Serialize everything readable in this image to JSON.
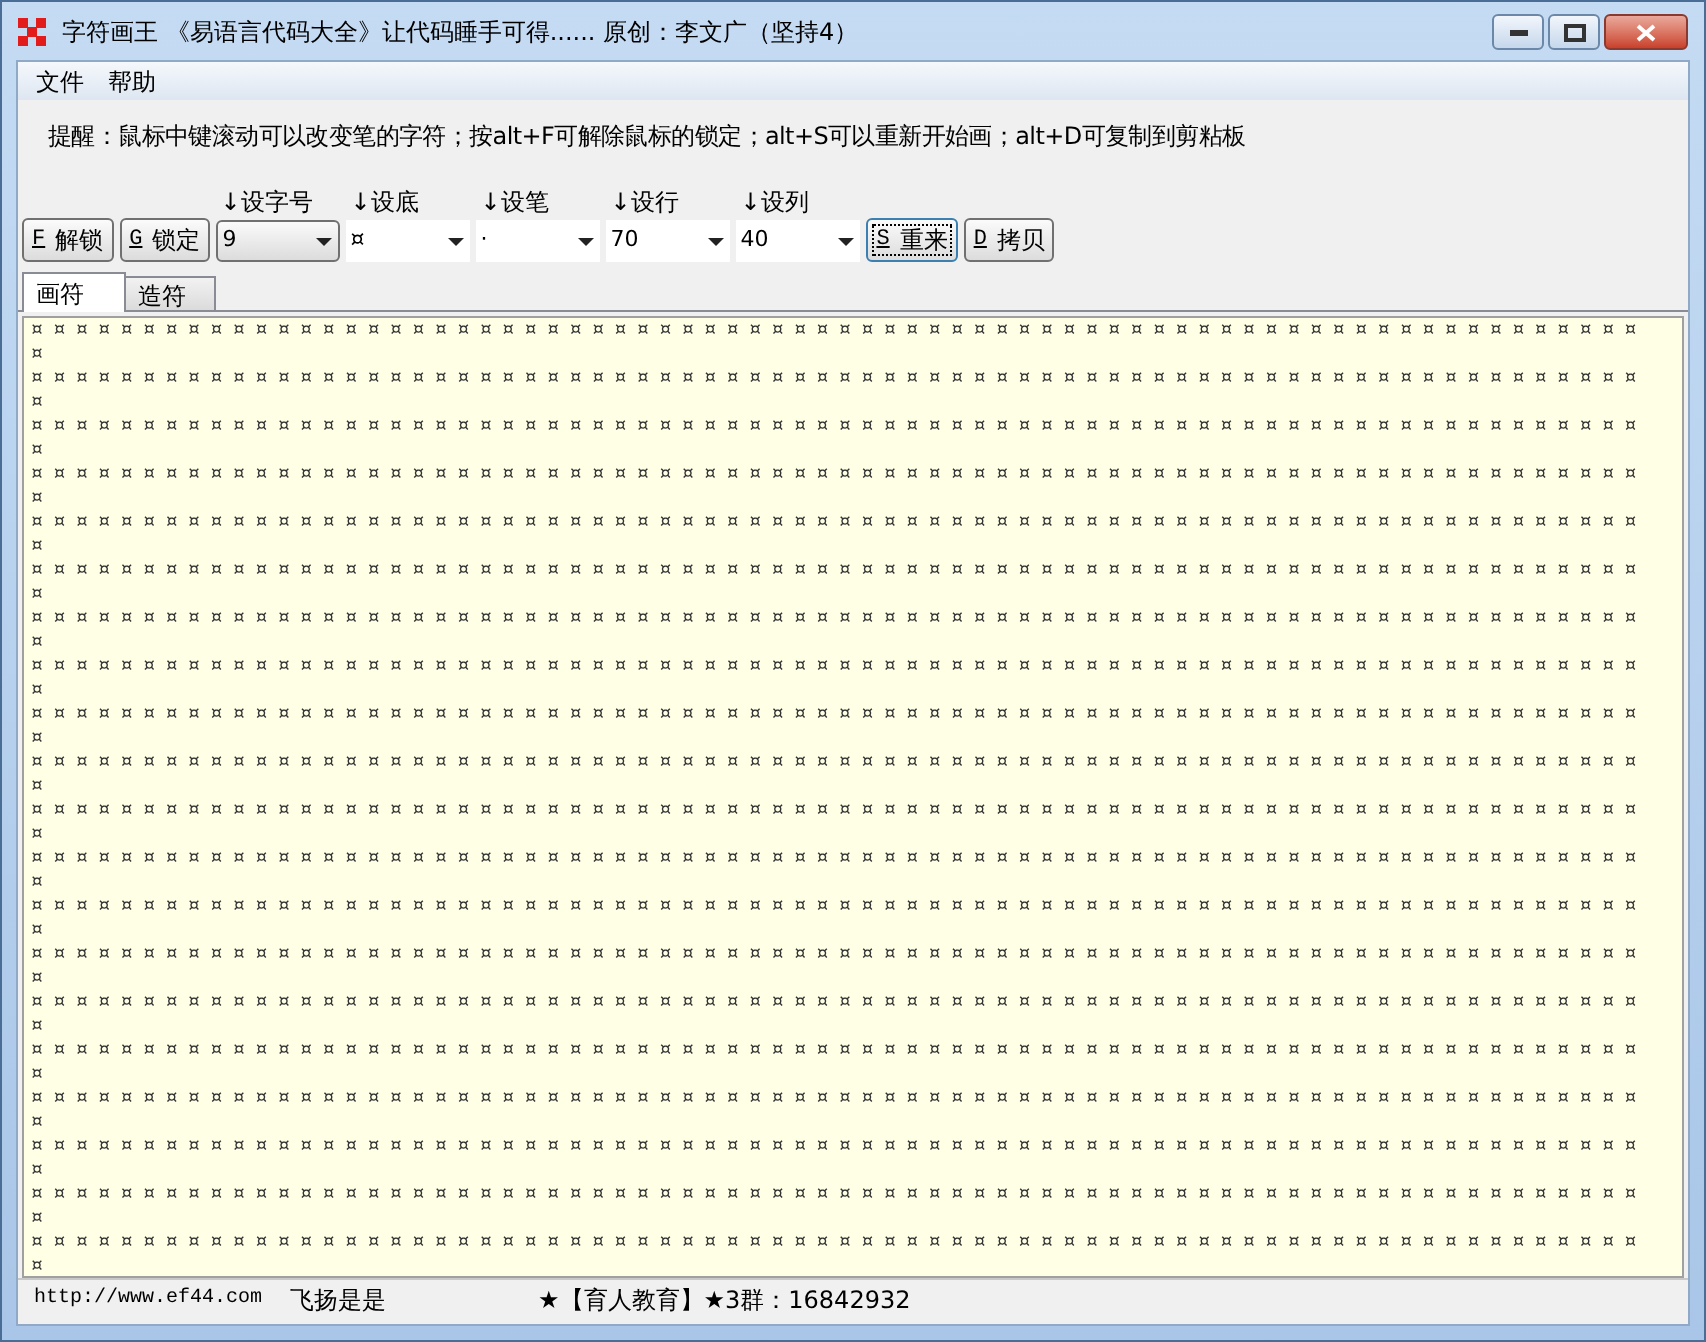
{
  "window": {
    "title": "字符画王 《易语言代码大全》让代码睡手可得...... 原创：李文广（坚持4）"
  },
  "menu": [
    "文件",
    "帮助"
  ],
  "hint": "提醒：鼠标中键滚动可以改变笔的字符；按alt+F可解除鼠标的锁定；alt+S可以重新开始画；alt+D可复制到剪粘板",
  "toolbar": [
    {
      "kind": "button",
      "key": "F",
      "label": "解锁",
      "focused": false
    },
    {
      "kind": "button",
      "key": "G",
      "label": "锁定",
      "focused": false
    },
    {
      "kind": "combo",
      "caption": "↓设字号",
      "value": "9"
    },
    {
      "kind": "combo",
      "caption": "↓设底",
      "value": "¤"
    },
    {
      "kind": "combo",
      "caption": "↓设笔",
      "value": "·"
    },
    {
      "kind": "combo",
      "caption": "↓设行",
      "value": "70"
    },
    {
      "kind": "combo",
      "caption": "↓设列",
      "value": "40"
    },
    {
      "kind": "button",
      "key": "S",
      "label": "重来",
      "focused": true
    },
    {
      "kind": "button",
      "key": "D",
      "label": "拷贝",
      "focused": false
    }
  ],
  "tabs": [
    {
      "label": "画符",
      "selected": true
    },
    {
      "label": "造符",
      "selected": false
    }
  ],
  "canvas": {
    "rows": [
      "¤¤¤¤¤¤¤¤¤¤¤¤¤¤¤¤¤¤¤¤¤¤¤¤¤¤¤¤¤¤¤¤¤¤¤¤¤¤¤¤¤¤¤¤¤¤¤¤¤¤¤¤¤¤¤¤¤¤¤¤¤¤¤¤¤¤¤¤¤¤¤¤¤",
      "¤¤¤¤¤¤¤¤¤¤¤¤¤¤¤¤¤¤¤¤¤¤¤¤¤¤¤¤¤¤¤¤¤¤¤¤¤¤¤¤¤¤¤¤¤¤¤¤¤¤¤¤¤¤¤¤¤¤¤¤¤¤¤¤¤¤¤¤¤¤¤¤¤",
      "¤¤¤¤¤¤¤¤¤¤¤¤¤¤¤¤¤¤¤¤¤¤¤¤¤¤¤¤¤¤¤¤¤¤¤¤¤¤¤¤¤¤¤¤¤¤¤¤¤¤¤¤¤¤¤¤¤¤¤¤¤¤¤¤¤¤¤¤¤¤¤¤¤",
      "¤¤¤¤¤¤¤¤¤¤¤¤¤¤¤¤¤¤¤¤¤¤¤¤¤¤¤¤¤¤¤¤¤¤¤¤¤¤¤¤¤¤¤¤¤¤¤¤¤¤¤¤¤¤¤¤¤¤¤¤¤¤¤¤¤¤¤¤¤¤¤¤¤",
      "¤¤¤¤¤¤¤¤¤¤¤¤¤¤¤¤¤¤¤¤¤¤¤¤¤¤¤¤¤¤¤¤¤¤¤¤¤¤¤¤¤¤¤¤¤¤¤¤¤¤¤¤¤¤¤¤¤¤¤¤¤¤¤¤¤¤¤¤¤¤¤¤¤",
      "¤¤¤¤¤¤¤¤¤¤¤¤¤¤¤¤¤¤¤¤¤¤¤¤¤¤¤¤¤¤¤¤¤¤¤¤¤¤¤¤¤¤¤¤¤¤¤¤¤¤¤¤¤¤¤¤¤¤¤¤¤¤¤¤¤¤¤¤¤¤¤¤¤",
      "¤¤¤¤¤¤¤¤¤¤¤¤¤¤¤¤¤¤¤¤¤¤¤¤¤¤¤¤¤¤¤¤¤¤¤¤¤¤¤¤¤¤¤¤¤¤¤¤¤¤¤¤¤¤¤¤¤¤¤¤¤¤¤¤¤¤¤¤¤¤¤¤¤",
      "¤¤¤¤¤¤¤¤¤¤¤¤¤¤¤¤¤¤¤¤¤¤¤¤¤¤¤¤¤¤¤¤¤¤¤¤¤¤¤¤¤¤¤¤¤¤¤¤¤¤¤¤¤¤¤¤¤¤¤¤¤¤¤¤¤¤¤¤¤¤¤¤¤",
      "¤¤¤¤¤¤¤¤¤¤¤¤¤¤¤¤¤¤¤¤¤¤¤¤¤¤¤¤¤¤¤¤¤¤¤¤¤¤¤¤¤¤¤¤¤¤¤¤¤¤¤¤¤¤¤¤¤¤¤¤¤¤¤¤¤¤¤¤¤¤¤¤¤",
      "¤¤¤¤¤¤¤¤¤¤¤¤¤¤¤¤¤¤¤¤¤¤¤¤¤¤¤¤¤¤¤¤¤¤¤¤¤¤¤¤¤¤¤¤¤¤¤¤¤¤¤¤¤¤¤¤¤¤¤¤¤¤¤¤¤¤¤¤¤¤¤¤¤",
      "¤¤¤¤¤¤¤¤¤¤¤¤¤¤¤¤¤¤¤¤¤¤¤¤¤¤¤¤¤¤¤¤¤¤¤¤¤¤¤¤¤¤¤¤¤¤¤¤¤¤¤¤¤¤¤¤¤¤¤¤¤¤¤¤¤¤¤¤¤¤¤¤¤",
      "¤¤¤¤¤¤¤¤¤¤¤¤¤¤¤¤¤¤¤¤¤¤¤¤¤¤¤¤¤¤¤¤¤¤¤¤¤¤¤¤¤¤¤¤¤¤¤¤¤¤¤¤¤¤¤¤¤¤¤¤¤¤¤¤¤¤¤¤¤¤¤¤¤",
      "¤¤¤¤¤¤¤¤¤¤¤¤¤¤¤¤¤¤¤¤¤¤¤¤¤¤¤¤¤¤¤¤¤¤¤¤¤¤¤¤¤¤¤¤¤¤¤¤¤¤¤¤¤¤¤¤¤¤¤¤¤¤¤¤¤¤¤¤¤¤¤¤¤",
      "¤¤¤¤¤¤¤¤¤¤¤¤¤¤¤¤¤¤¤¤¤¤¤¤¤¤¤¤¤¤¤¤¤¤¤¤¤¤¤¤¤¤¤¤¤¤¤¤¤¤¤¤¤¤¤¤¤¤¤¤¤¤¤¤¤¤¤¤¤¤¤¤¤",
      "¤¤¤¤¤¤¤¤¤¤¤¤¤¤¤¤¤¤¤¤¤¤¤¤¤¤¤¤¤¤¤¤¤¤¤¤¤¤¤¤¤¤¤¤¤¤¤¤¤¤¤¤¤¤¤¤¤¤¤¤¤¤¤¤¤¤¤¤¤¤¤¤¤",
      "¤¤¤¤¤¤¤¤¤¤¤¤¤¤¤¤¤¤¤¤¤¤¤¤¤¤¤¤¤¤¤¤¤¤¤¤¤¤¤¤¤¤¤¤¤¤¤¤¤¤¤¤¤¤¤¤¤¤¤¤¤¤¤¤¤¤¤¤¤¤¤¤¤",
      "¤¤¤¤¤¤¤¤¤¤¤¤¤¤¤¤¤¤¤¤¤¤¤¤¤¤¤¤¤¤¤¤¤¤¤¤¤¤¤¤¤¤¤¤¤¤¤¤¤¤¤¤¤¤¤¤¤¤¤¤¤¤¤¤¤¤¤¤¤¤¤¤¤",
      "¤¤¤¤¤¤¤¤¤¤¤¤¤¤¤¤¤¤¤¤¤¤¤¤¤¤¤¤¤¤¤¤¤¤¤¤¤¤¤¤¤¤¤¤¤¤¤¤¤¤¤¤¤¤¤¤¤¤¤¤¤¤¤¤¤¤¤¤¤¤¤¤¤",
      "¤¤¤¤¤¤¤¤¤¤¤¤¤¤¤¤¤¤¤¤¤¤¤¤¤¤¤¤¤¤¤¤¤¤¤¤¤¤¤¤¤¤¤¤¤¤¤¤¤¤¤¤¤¤¤¤¤¤¤¤¤¤¤¤¤¤¤¤¤¤¤¤¤",
      "¤¤¤¤¤¤¤¤¤¤¤¤¤¤¤¤¤¤¤¤¤¤¤¤¤¤¤¤¤¤¤¤¤¤¤¤¤¤¤¤¤¤¤¤¤¤¤¤¤¤¤¤¤¤¤¤¤¤¤¤¤¤¤¤¤¤¤¤¤¤¤¤¤"
    ]
  },
  "status_bar": [
    "http://www.ef44.com",
    "飞扬是是",
    "★【育人教育】★3群：16842932"
  ]
}
